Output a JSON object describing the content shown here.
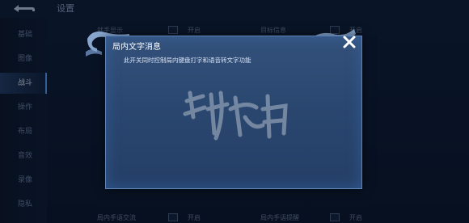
{
  "header": {
    "title": "设置"
  },
  "sidebar": {
    "items": [
      {
        "label": "基础"
      },
      {
        "label": "图像"
      },
      {
        "label": "战斗"
      },
      {
        "label": "操作"
      },
      {
        "label": "布局"
      },
      {
        "label": "音效"
      },
      {
        "label": "录像"
      },
      {
        "label": "隐私"
      }
    ],
    "active_index": 2
  },
  "background": {
    "labels": [
      {
        "text": "就手显示"
      },
      {
        "text": "开启"
      },
      {
        "text": "目标信息"
      },
      {
        "text": "开启"
      },
      {
        "text": "局内手语交流"
      },
      {
        "text": "开启"
      },
      {
        "text": "局内手语提醒"
      },
      {
        "text": "开启"
      }
    ]
  },
  "modal": {
    "title": "局内文字消息",
    "body": "此开关同时控制局内键盘打字和语音转文字功能",
    "close_icon": "close-icon"
  },
  "colors": {
    "accent": "#5aa3ff",
    "modal_bg": "#2a4770",
    "modal_border": "#5f84b6"
  }
}
